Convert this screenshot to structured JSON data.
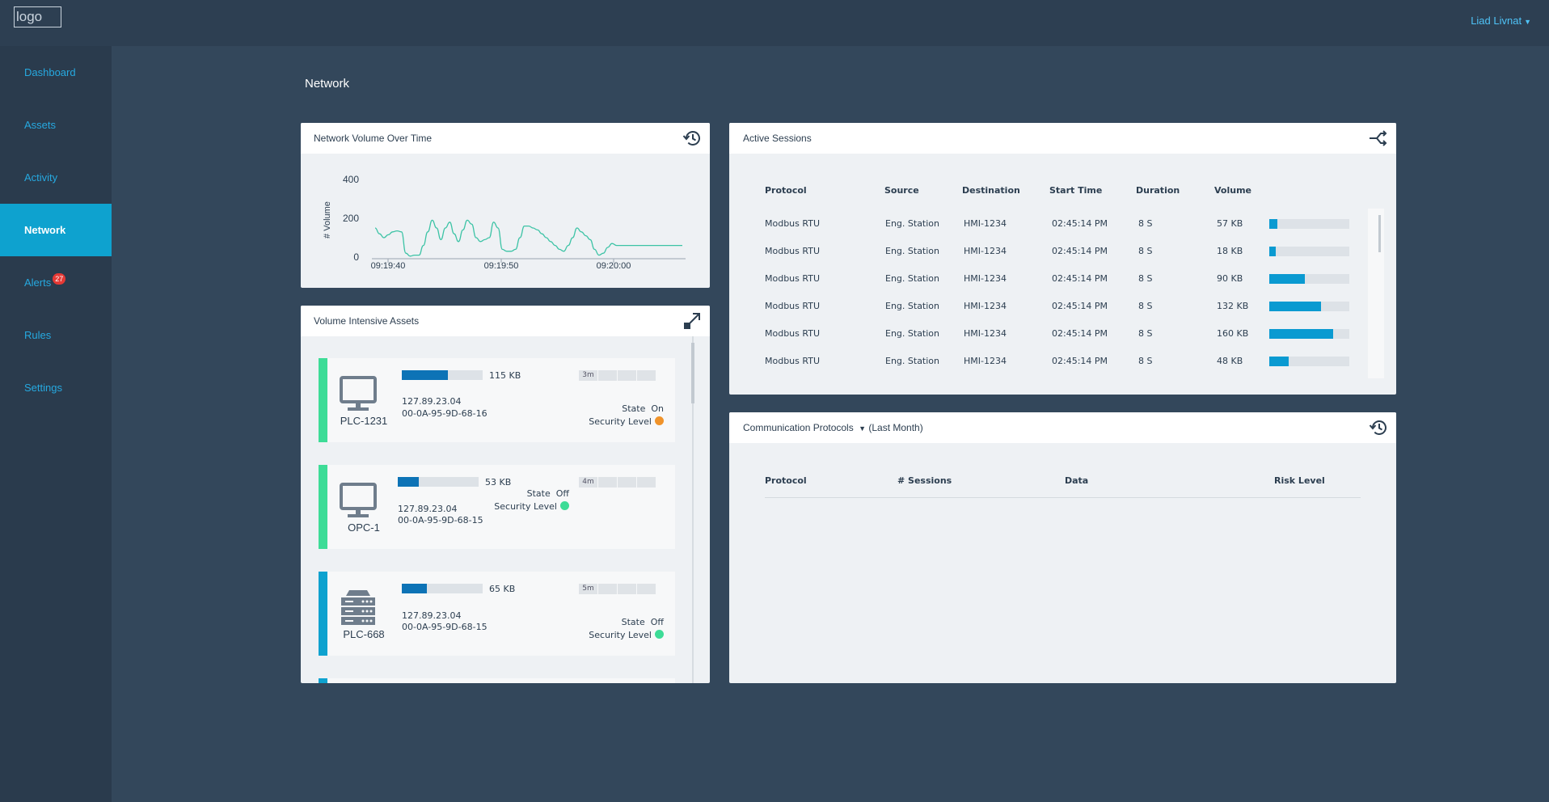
{
  "header": {
    "logo_alt": "logo",
    "user_name": "Liad Livnat"
  },
  "sidebar": {
    "items": [
      {
        "label": "Dashboard"
      },
      {
        "label": "Assets"
      },
      {
        "label": "Activity"
      },
      {
        "label": "Network"
      },
      {
        "label": "Alerts",
        "badge": "27"
      },
      {
        "label": "Rules"
      },
      {
        "label": "Settings"
      }
    ],
    "active": "Network"
  },
  "page": {
    "title": "Network"
  },
  "volume_panel": {
    "title": "Network Volume Over Time",
    "icon": "history-icon"
  },
  "chart_data": {
    "type": "line",
    "title": "",
    "xlabel": "",
    "ylabel": "# Volume",
    "ylim": [
      0,
      400
    ],
    "yticks": [
      "400",
      "200",
      "0"
    ],
    "xticks": [
      "09:19:40",
      "09:19:50",
      "09:20:00"
    ],
    "series": [
      {
        "color": "#3cc3a5",
        "x": [
          0,
          1,
          2,
          3,
          4,
          5,
          6,
          7,
          8,
          9,
          10,
          11,
          12,
          13,
          14,
          15,
          16,
          17,
          18,
          19,
          20,
          21,
          22,
          23,
          24,
          25,
          26,
          27,
          28,
          29,
          30,
          31,
          32,
          33,
          34,
          35,
          36,
          37,
          38,
          39,
          40,
          41,
          42,
          43,
          44,
          45,
          46,
          47,
          48,
          49,
          50,
          51,
          52,
          53,
          54,
          55,
          56,
          57,
          58,
          59,
          60,
          61,
          62,
          63,
          64,
          65,
          66,
          67,
          68,
          69,
          70
        ],
        "values": [
          150,
          120,
          100,
          115,
          130,
          135,
          130,
          20,
          5,
          10,
          10,
          60,
          130,
          190,
          150,
          90,
          150,
          180,
          120,
          80,
          140,
          190,
          170,
          100,
          80,
          90,
          100,
          180,
          150,
          40,
          30,
          30,
          40,
          100,
          160,
          160,
          150,
          140,
          120,
          100,
          80,
          60,
          40,
          30,
          60,
          100,
          150,
          130,
          110,
          90,
          40,
          10,
          20,
          50,
          70,
          60,
          60,
          60,
          60,
          60,
          60,
          60,
          60,
          60,
          60,
          60,
          60,
          60,
          60,
          60,
          60
        ]
      }
    ]
  },
  "assets_panel": {
    "title": "Volume Intensive Assets",
    "icon": "expand-icon",
    "assets": [
      {
        "name": "PLC-1231",
        "volume": "115 KB",
        "fill": 0.57,
        "ip": "127.89.23.04",
        "mac": "00-0A-95-9D-68-16",
        "time": "3m",
        "state_label": "State",
        "state": "On",
        "security_label": "Security Level",
        "security_color": "#f0932a",
        "stripe": "#3ddc97",
        "icon": "monitor-icon"
      },
      {
        "name": "OPC-1",
        "volume": "53 KB",
        "fill": 0.26,
        "ip": "127.89.23.04",
        "mac": "00-0A-95-9D-68-15",
        "time": "4m",
        "state_label": "State",
        "state": "Off",
        "security_label": "Security Level",
        "security_color": "#3ddc97",
        "stripe": "#3ddc97",
        "icon": "monitor-icon"
      },
      {
        "name": "PLC-668",
        "volume": "65 KB",
        "fill": 0.31,
        "ip": "127.89.23.04",
        "mac": "00-0A-95-9D-68-15",
        "time": "5m",
        "state_label": "State",
        "state": "Off",
        "security_label": "Security Level",
        "security_color": "#3ddc97",
        "stripe": "#0ea2cf",
        "icon": "server-icon"
      }
    ]
  },
  "sessions_panel": {
    "title": "Active Sessions",
    "icon": "split-icon",
    "columns": [
      "Protocol",
      "Source",
      "Destination",
      "Start Time",
      "Duration",
      "Volume"
    ],
    "rows": [
      {
        "protocol": "Modbus RTU",
        "source": "Eng. Station",
        "destination": "HMI-1234",
        "start": "02:45:14 PM",
        "duration": "8 S",
        "volume": "57 KB",
        "fill": 0.1
      },
      {
        "protocol": "Modbus RTU",
        "source": "Eng. Station",
        "destination": "HMI-1234",
        "start": "02:45:14 PM",
        "duration": "8 S",
        "volume": "18 KB",
        "fill": 0.08
      },
      {
        "protocol": "Modbus RTU",
        "source": "Eng. Station",
        "destination": "HMI-1234",
        "start": "02:45:14 PM",
        "duration": "8 S",
        "volume": "90 KB",
        "fill": 0.44
      },
      {
        "protocol": "Modbus RTU",
        "source": "Eng. Station",
        "destination": "HMI-1234",
        "start": "02:45:14 PM",
        "duration": "8 S",
        "volume": "132 KB",
        "fill": 0.65
      },
      {
        "protocol": "Modbus RTU",
        "source": "Eng. Station",
        "destination": "HMI-1234",
        "start": "02:45:14 PM",
        "duration": "8 S",
        "volume": "160 KB",
        "fill": 0.8
      },
      {
        "protocol": "Modbus RTU",
        "source": "Eng. Station",
        "destination": "HMI-1234",
        "start": "02:45:14 PM",
        "duration": "8 S",
        "volume": "48 KB",
        "fill": 0.24
      }
    ]
  },
  "protocols_panel": {
    "title": "Communication Protocols",
    "period": "(Last Month)",
    "icon": "history-icon",
    "columns": [
      "Protocol",
      "# Sessions",
      "Data",
      "Risk Level"
    ]
  }
}
